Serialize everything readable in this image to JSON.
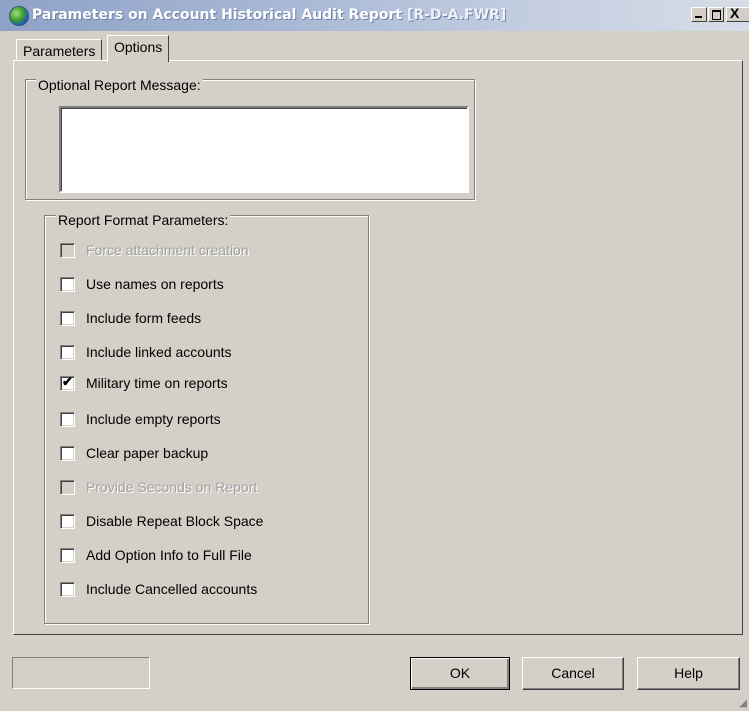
{
  "window": {
    "title": "Parameters on Account Historical Audit Report",
    "title_file": "[R-D-A.FWR]",
    "close_glyph": "X"
  },
  "tabs": [
    {
      "label": "Parameters",
      "active": false
    },
    {
      "label": "Options",
      "active": true
    }
  ],
  "message_group": {
    "label": "Optional Report Message:",
    "value": ""
  },
  "format_group": {
    "label": "Report Format Parameters:",
    "options": [
      {
        "label": "Force attachment creation",
        "checked": false,
        "enabled": false
      },
      {
        "label": "Use names on reports",
        "checked": false,
        "enabled": true
      },
      {
        "label": "Include form feeds",
        "checked": false,
        "enabled": true
      },
      {
        "label": "Include linked accounts",
        "checked": false,
        "enabled": true
      },
      {
        "label": "Military time on reports",
        "checked": true,
        "enabled": true
      },
      {
        "label": "Include empty reports",
        "checked": false,
        "enabled": true
      },
      {
        "label": "Clear paper backup",
        "checked": false,
        "enabled": true
      },
      {
        "label": "Provide Seconds on Report",
        "checked": false,
        "enabled": false
      },
      {
        "label": "Disable Repeat Block Space",
        "checked": false,
        "enabled": true
      },
      {
        "label": "Add Option Info to Full File",
        "checked": false,
        "enabled": true
      },
      {
        "label": "Include Cancelled accounts",
        "checked": false,
        "enabled": true
      }
    ]
  },
  "buttons": {
    "ok": "OK",
    "cancel": "Cancel",
    "help": "Help"
  },
  "check_glyph": "✔"
}
